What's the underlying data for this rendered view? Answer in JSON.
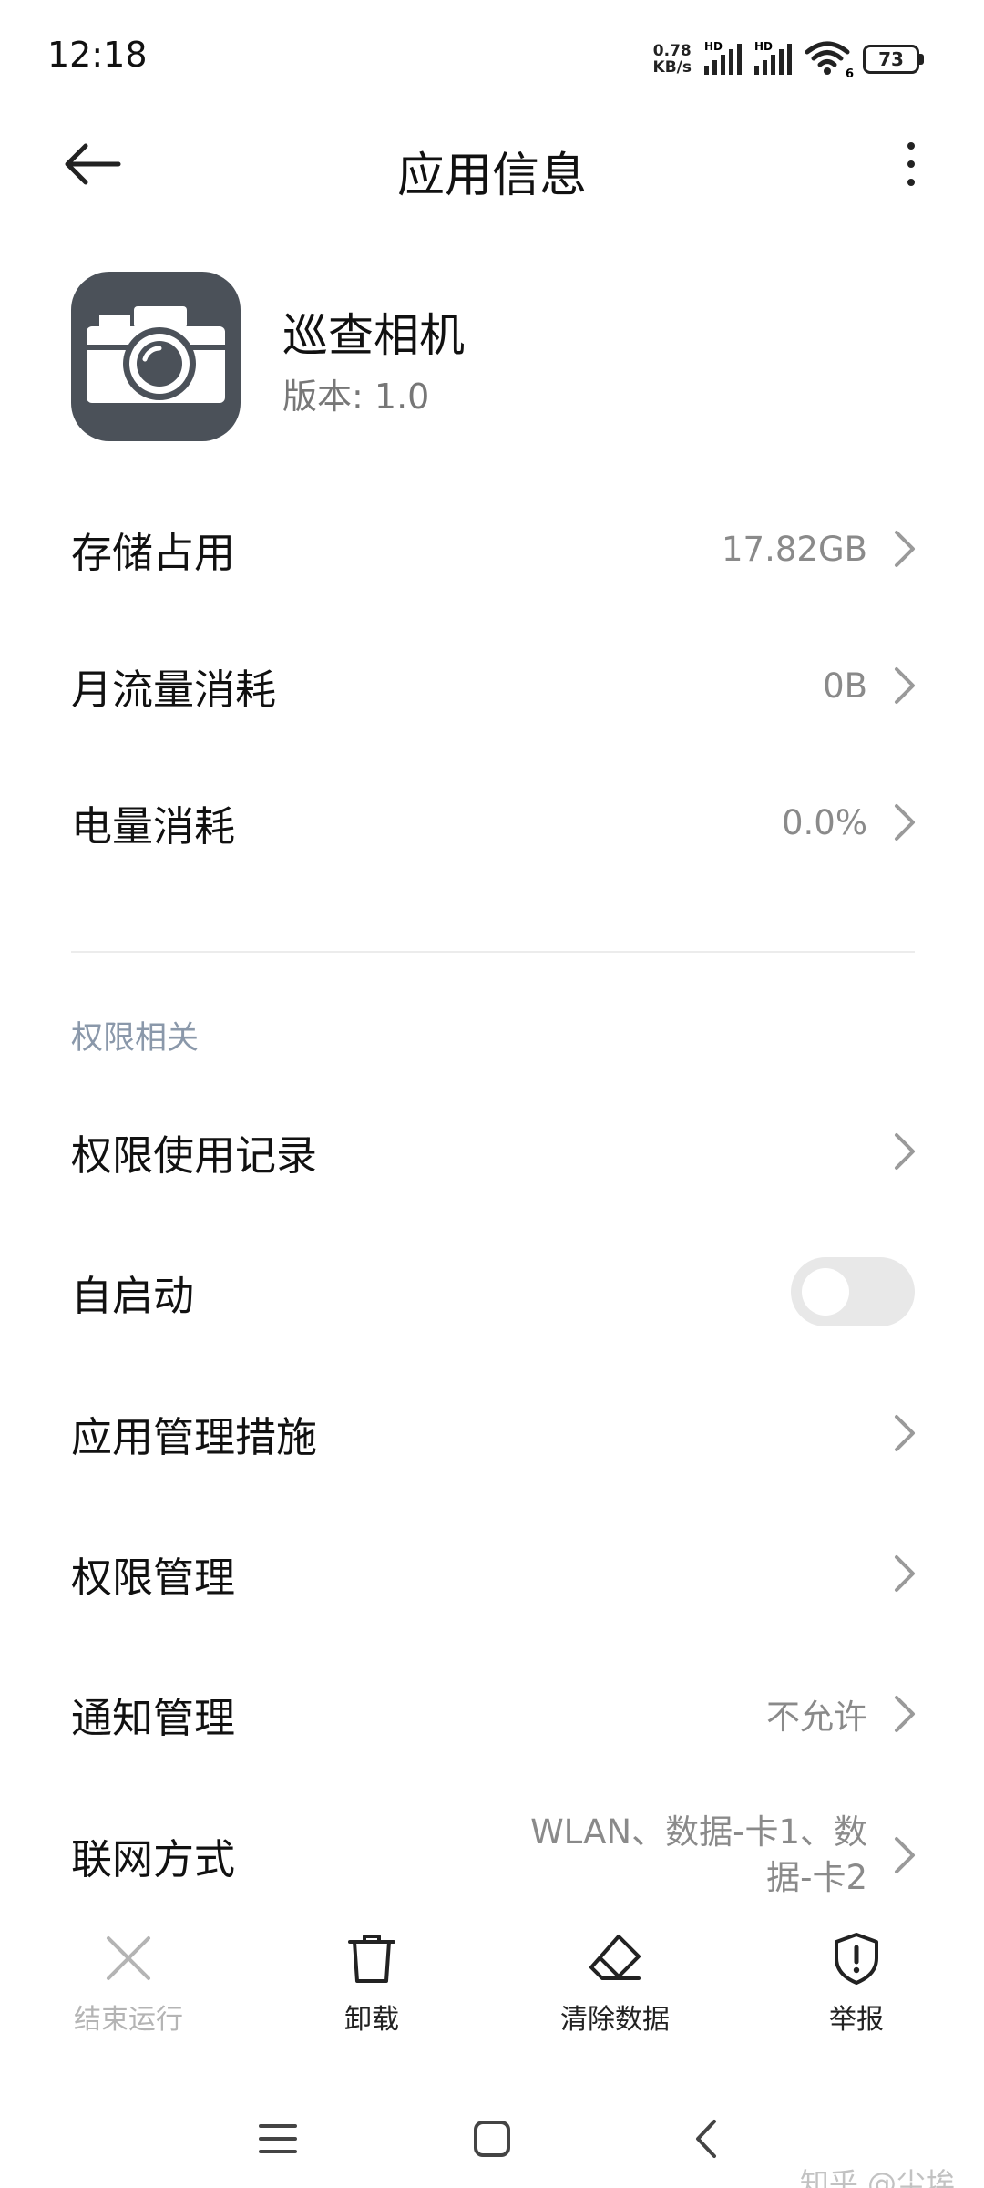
{
  "status_bar": {
    "time": "12:18",
    "net_speed_value": "0.78",
    "net_speed_unit": "KB/s",
    "sim1_label": "HD",
    "sim2_label": "HD",
    "wifi_label": "6",
    "battery": "73"
  },
  "header": {
    "title": "应用信息",
    "back_icon": "arrow-left-icon",
    "more_icon": "more-vertical-icon"
  },
  "app": {
    "name": "巡查相机",
    "version_label": "版本:",
    "version_value": "1.0",
    "icon": "camera-icon",
    "icon_bg": "#4b5159"
  },
  "usage": {
    "storage_label": "存储占用",
    "storage_value": "17.82GB",
    "data_label": "月流量消耗",
    "data_value": "0B",
    "battery_label": "电量消耗",
    "battery_value": "0.0%"
  },
  "permissions": {
    "section_title": "权限相关",
    "usage_record_label": "权限使用记录",
    "autostart_label": "自启动",
    "autostart_enabled": false,
    "management_measures_label": "应用管理措施",
    "permission_management_label": "权限管理",
    "notification_label": "通知管理",
    "notification_value": "不允许",
    "network_label": "联网方式",
    "network_value": "WLAN、数据-卡1、数据-卡2"
  },
  "actions": {
    "force_stop": "结束运行",
    "uninstall": "卸载",
    "clear_data": "清除数据",
    "report": "举报"
  },
  "watermark": "知乎 @尘埃",
  "colors": {
    "section_title": "#8a98aa",
    "value_text": "#8a8a8a",
    "toggle_off": "#e8e8e8",
    "disabled": "#b4b4b4"
  }
}
